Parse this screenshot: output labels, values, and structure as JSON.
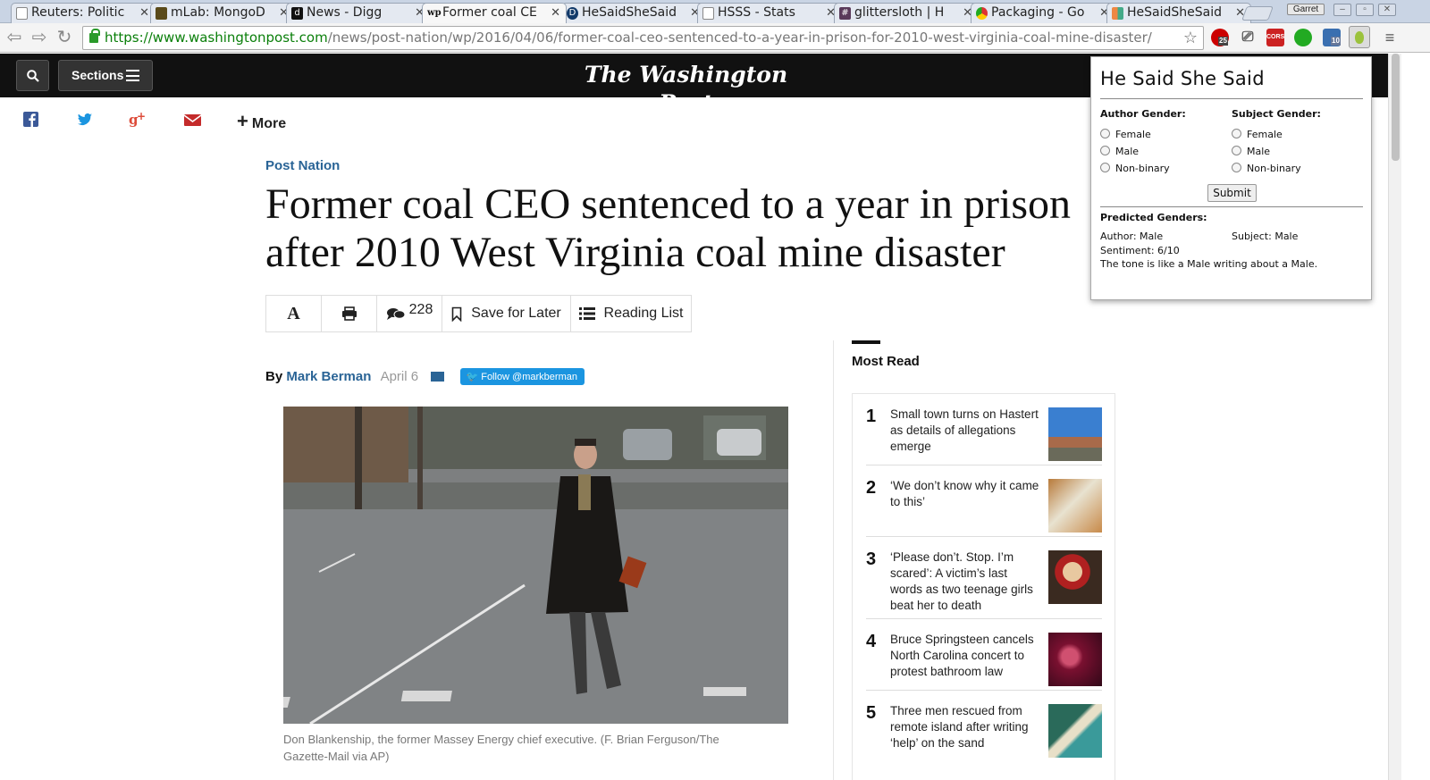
{
  "browser": {
    "tabs": [
      {
        "title": "Reuters: Politic",
        "active": false
      },
      {
        "title": "mLab: MongoD",
        "active": false
      },
      {
        "title": "News - Digg",
        "active": false
      },
      {
        "title": "Former coal CE",
        "active": true
      },
      {
        "title": "HeSaidSheSaid",
        "active": false
      },
      {
        "title": "HSSS - Stats",
        "active": false
      },
      {
        "title": "glittersloth | H",
        "active": false
      },
      {
        "title": "Packaging - Go",
        "active": false
      },
      {
        "title": "HeSaidSheSaid",
        "active": false
      }
    ],
    "profile_name": "Garret",
    "url_scheme": "https://",
    "url_host": "www.washingtonpost.com",
    "url_path": "/news/post-nation/wp/2016/04/06/former-coal-ceo-sentenced-to-a-year-in-prison-for-2010-west-virginia-coal-mine-disaster/",
    "extension_badges": {
      "ublock": "25",
      "cors": "CORS",
      "window": "10"
    }
  },
  "site": {
    "sections_label": "Sections",
    "logo": "The Washington Post",
    "more_label": "More",
    "kicker": "Post Nation",
    "headline": "Former coal CEO sentenced to a year in prison after 2010 West Virginia coal mine disaster",
    "tools": {
      "font_label": "A",
      "comment_count": "228",
      "save_label": "Save for Later",
      "reading_list_label": "Reading List"
    },
    "byline_prefix": "By",
    "author": "Mark Berman",
    "date": "April 6",
    "follow_label": "Follow @markberman",
    "caption": "Don Blankenship, the former Massey Energy chief executive. (F. Brian Ferguson/The Gazette-Mail via AP)",
    "most_read": {
      "title": "Most Read",
      "items": [
        {
          "num": "1",
          "text": "Small town turns on Hastert as details of allegations emerge"
        },
        {
          "num": "2",
          "text": "‘We don’t know why it came to this’"
        },
        {
          "num": "3",
          "text": "‘Please don’t. Stop. I’m scared’: A victim’s last words as two teenage girls beat her to death"
        },
        {
          "num": "4",
          "text": "Bruce Springsteen cancels North Carolina concert to protest bathroom law"
        },
        {
          "num": "5",
          "text": "Three men rescued from remote island after writing ‘help’ on the sand"
        }
      ]
    }
  },
  "popup": {
    "title": "He Said She Said",
    "author_gender_label": "Author Gender:",
    "subject_gender_label": "Subject Gender:",
    "options": [
      "Female",
      "Male",
      "Non-binary"
    ],
    "submit_label": "Submit",
    "predicted_label": "Predicted Genders:",
    "author_line": "Author: Male",
    "subject_line": "Subject: Male",
    "sentiment_line": "Sentiment: 6/10",
    "tone_line": "The tone is like a Male writing about a Male."
  },
  "colors": {
    "link_blue": "#2a6496",
    "twitter": "#1b95e0",
    "header_bg": "#111111",
    "url_green": "#0a7f0a"
  }
}
